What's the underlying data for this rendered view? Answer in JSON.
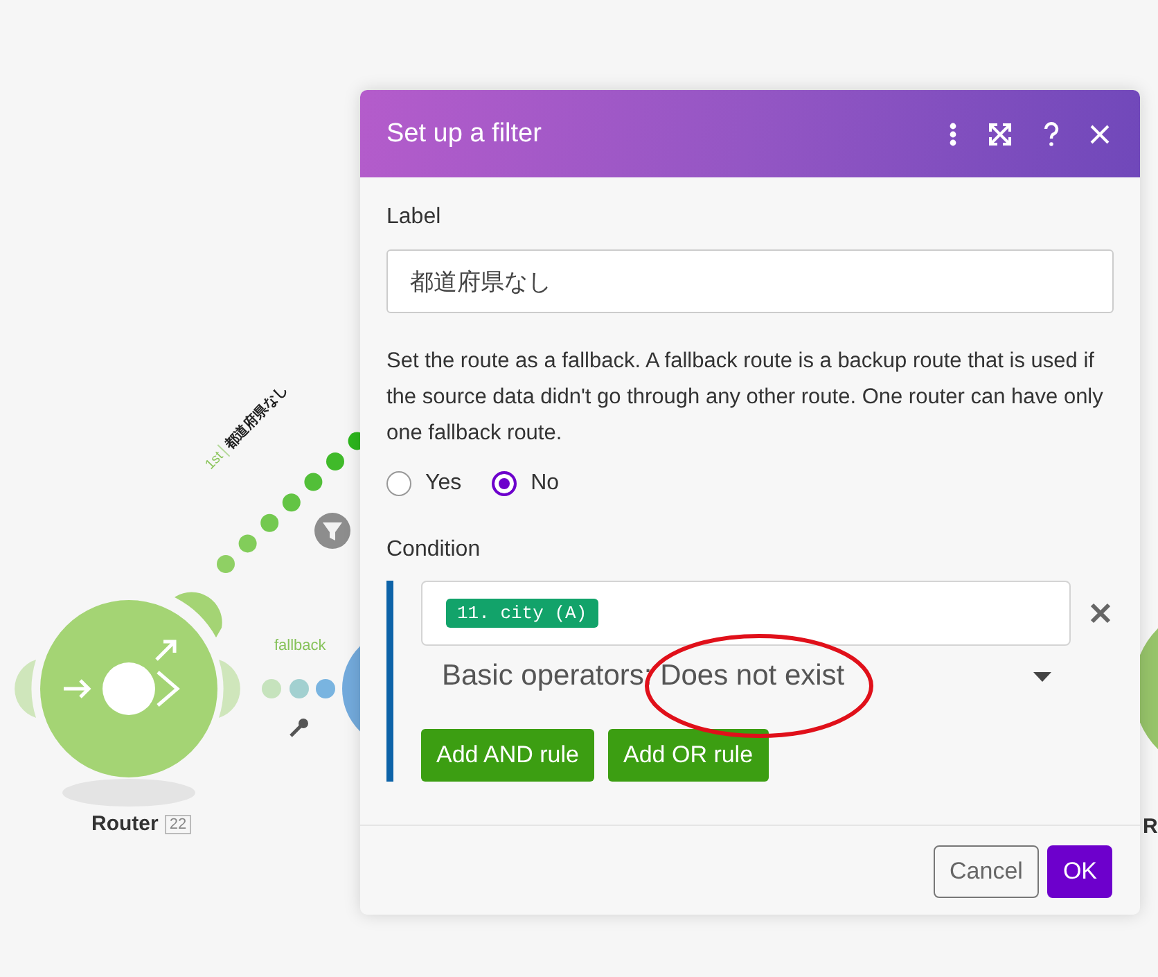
{
  "canvas": {
    "router": {
      "label": "Router",
      "badge": "22"
    },
    "routes": [
      {
        "kind": "filtered",
        "order": "1st",
        "label": "都道府県なし"
      },
      {
        "kind": "fallback",
        "label": "fallback"
      }
    ],
    "next_module": {
      "label": "R"
    }
  },
  "dialog": {
    "title": "Set up a filter",
    "label_field": {
      "label": "Label",
      "value": "都道府県なし"
    },
    "fallback": {
      "description": "Set the route as a fallback. A fallback route is a backup route that is used if the source data didn't go through any other route. One router can have only one fallback route.",
      "options": [
        {
          "label": "Yes",
          "selected": false
        },
        {
          "label": "No",
          "selected": true
        }
      ]
    },
    "condition": {
      "label": "Condition",
      "rules": [
        {
          "token": "11. city (A)",
          "operator": "Basic operators: Does not exist"
        }
      ],
      "buttons": [
        "Add AND rule",
        "Add OR rule"
      ]
    },
    "footer": {
      "cancel": "Cancel",
      "ok": "OK"
    }
  }
}
